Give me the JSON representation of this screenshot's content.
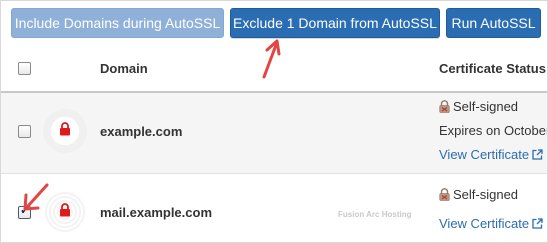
{
  "toolbar": {
    "include_label": "Include Domains during AutoSSL",
    "exclude_label": "Exclude 1 Domain from AutoSSL",
    "run_label": "Run AutoSSL"
  },
  "table": {
    "columns": {
      "domain": "Domain",
      "certificate_status": "Certificate Status"
    },
    "rows": [
      {
        "domain": "example.com",
        "checked": false,
        "status": "Self-signed",
        "expires": "Expires on October",
        "view_link": "View Certificate"
      },
      {
        "domain": "mail.example.com",
        "checked": true,
        "status": "Self-signed",
        "view_link": "View Certificate"
      }
    ]
  },
  "watermark": "Fusion Arc Hosting",
  "colors": {
    "primary_button": "#2a6db3",
    "disabled_button": "#8fb1d9",
    "lock_red": "#e0191f",
    "annotation_arrow": "#e34545",
    "link": "#2a6db3"
  },
  "icons": [
    "lock-icon",
    "padlock-small-icon",
    "external-link-icon",
    "checkbox",
    "annotation-arrow"
  ]
}
